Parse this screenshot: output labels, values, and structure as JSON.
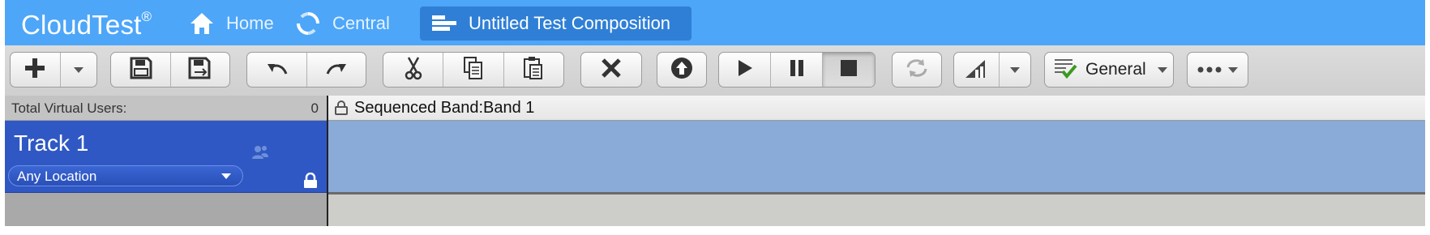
{
  "app": {
    "logo": "CloudTest",
    "logo_mark": "®"
  },
  "nav": {
    "home": {
      "label": "Home",
      "icon": "home-icon"
    },
    "central": {
      "label": "Central",
      "icon": "refresh-ring-icon"
    },
    "composition": {
      "label": "Untitled Test Composition",
      "icon": "composition-icon"
    }
  },
  "toolbar": {
    "icons": [
      "plus-icon",
      "chevron-down-icon",
      "save-icon",
      "save-as-icon",
      "undo-icon",
      "redo-icon",
      "cut-icon",
      "copy-icon",
      "paste-icon",
      "delete-icon",
      "upload-icon",
      "play-icon",
      "pause-icon",
      "stop-icon",
      "sync-icon",
      "meter-icon",
      "checklist-icon",
      "more-icon"
    ],
    "general_label": "General"
  },
  "virtual_users": {
    "label": "Total Virtual Users:",
    "count": "0"
  },
  "track": {
    "title": "Track 1",
    "location": "Any Location"
  },
  "band": {
    "title": "Sequenced Band:Band 1"
  },
  "colors": {
    "topbar": "#4da6f8",
    "active_tab": "#2f7fd6",
    "track": "#2f58c4",
    "band_lane": "#8aaad7"
  }
}
